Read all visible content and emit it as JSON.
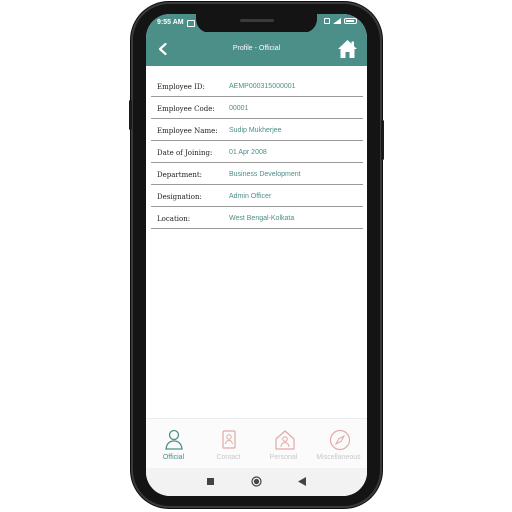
{
  "status_bar": {
    "time": "9:55 AM"
  },
  "app_bar": {
    "title": "Profile - Official"
  },
  "fields": [
    {
      "label": "Employee ID:",
      "value": "AEMP000315000001"
    },
    {
      "label": "Employee Code:",
      "value": "00001"
    },
    {
      "label": "Employee Name:",
      "value": "Sudip Mukherjee"
    },
    {
      "label": "Date of Joining:",
      "value": "01 Apr 2008"
    },
    {
      "label": "Department:",
      "value": "Business Development"
    },
    {
      "label": "Designation:",
      "value": "Admin Officer"
    },
    {
      "label": "Location:",
      "value": "West Bengal-Kolkata"
    }
  ],
  "bottom_nav": {
    "active": "Official",
    "tabs": [
      {
        "label": "Official",
        "icon": "person-icon"
      },
      {
        "label": "Contact",
        "icon": "contact-card-icon"
      },
      {
        "label": "Personal",
        "icon": "home-person-icon"
      },
      {
        "label": "Miscellaneous",
        "icon": "compass-icon"
      }
    ]
  },
  "colors": {
    "primary": "#4b8f88",
    "inactive": "#e3a8a8",
    "inactive_text": "#c8c8c8"
  }
}
